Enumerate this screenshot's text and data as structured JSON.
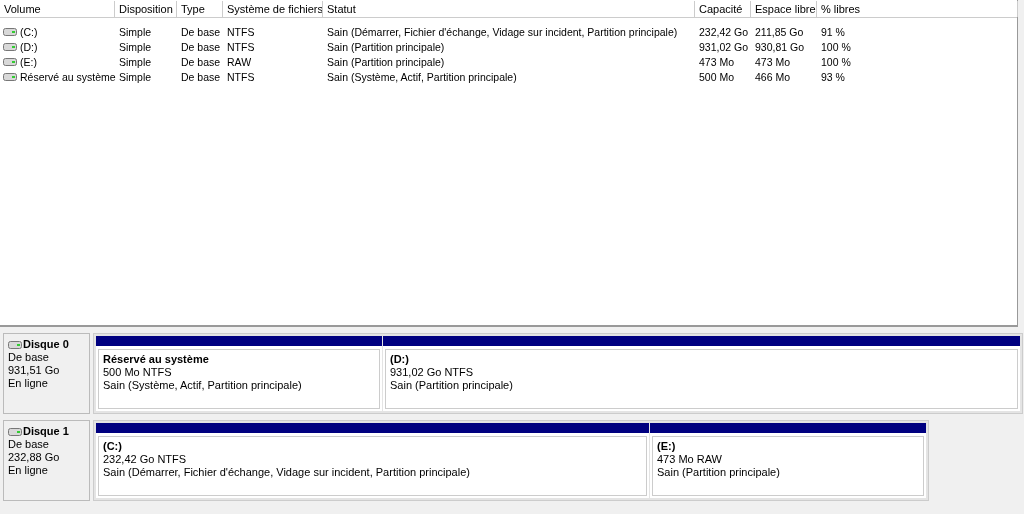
{
  "volume_table": {
    "columns": [
      "Volume",
      "Disposition",
      "Type",
      "Système de fichiers",
      "Statut",
      "Capacité",
      "Espace libre",
      "% libres"
    ],
    "rows": [
      {
        "cells": [
          "(C:)",
          "Simple",
          "De base",
          "NTFS",
          "Sain (Démarrer, Fichier d'échange, Vidage sur incident, Partition principale)",
          "232,42 Go",
          "211,85 Go",
          "91 %"
        ]
      },
      {
        "cells": [
          "(D:)",
          "Simple",
          "De base",
          "NTFS",
          "Sain (Partition principale)",
          "931,02 Go",
          "930,81 Go",
          "100 %"
        ]
      },
      {
        "cells": [
          "(E:)",
          "Simple",
          "De base",
          "RAW",
          "Sain (Partition principale)",
          "473 Mo",
          "473 Mo",
          "100 %"
        ]
      },
      {
        "cells": [
          "Réservé au système",
          "Simple",
          "De base",
          "NTFS",
          "Sain (Système, Actif, Partition principale)",
          "500 Mo",
          "466 Mo",
          "93 %"
        ]
      }
    ]
  },
  "disks": [
    {
      "name": "Disque 0",
      "type": "De base",
      "size": "931,51 Go",
      "status": "En ligne",
      "partitions": [
        {
          "name": "Réservé au système",
          "size": "500 Mo NTFS",
          "status": "Sain (Système, Actif, Partition principale)"
        },
        {
          "name": "(D:)",
          "size": "931,02 Go NTFS",
          "status": "Sain (Partition principale)"
        }
      ]
    },
    {
      "name": "Disque 1",
      "type": "De base",
      "size": "232,88 Go",
      "status": "En ligne",
      "partitions": [
        {
          "name": "(C:)",
          "size": "232,42 Go NTFS",
          "status": "Sain (Démarrer, Fichier d'échange, Vidage sur incident, Partition principale)"
        },
        {
          "name": "(E:)",
          "size": "473 Mo RAW",
          "status": "Sain (Partition principale)"
        }
      ]
    }
  ]
}
